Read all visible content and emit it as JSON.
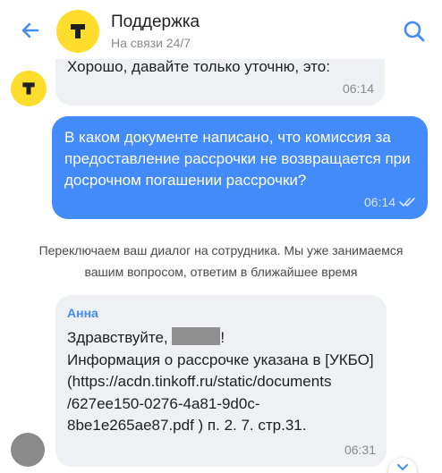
{
  "header": {
    "title": "Поддержка",
    "subtitle": "На связи 24/7",
    "back_icon": "arrow-left-icon",
    "search_icon": "search-icon",
    "logo_icon": "tinkoff-logo-icon"
  },
  "colors": {
    "accent": "#428bf9",
    "brand_yellow": "#ffdd2d",
    "incoming_bubble": "#eef0f3"
  },
  "messages": [
    {
      "from": "bot",
      "text": "Хорошо, давайте только уточню, это:",
      "time": "06:14"
    },
    {
      "from": "user",
      "text": "В каком документе написано, что комиссия за предоставление рассрочки не возвращается при досрочном погашении рассрочки?",
      "time": "06:14",
      "status_icon": "double-check-icon"
    },
    {
      "from": "system",
      "text": "Переключаем ваш диалог на сотрудника. Мы уже занимаемся вашим вопросом, ответим в ближайшее время"
    },
    {
      "from": "agent",
      "sender": "Анна",
      "greeting_start": "Здравствуйте, ",
      "greeting_end": "!",
      "body": "Информация о рассрочке указана в [УКБО] (https://acdn.tinkoff.ru/static/documents /627ee150-0276-4a81-9d0c-8be1e265ae87.pdf ) п. 2. 7. стр.31.",
      "time": "06:31"
    }
  ]
}
